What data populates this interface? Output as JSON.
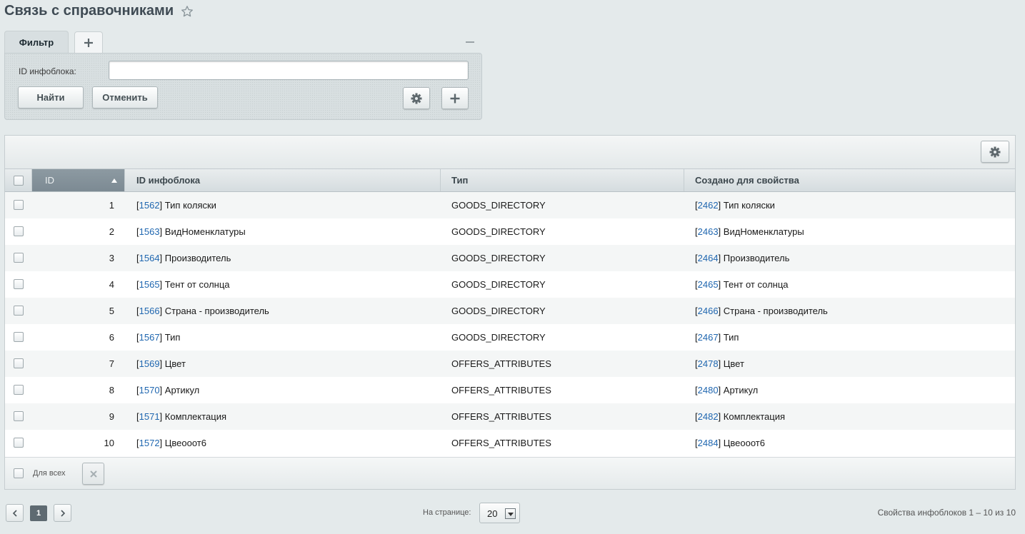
{
  "page": {
    "title": "Связь с справочниками"
  },
  "filter": {
    "tab_label": "Фильтр",
    "field_label": "ID инфоблока:",
    "field_value": "",
    "find_label": "Найти",
    "cancel_label": "Отменить"
  },
  "grid": {
    "columns": {
      "id": "ID",
      "iblock": "ID инфоблока",
      "type": "Тип",
      "prop": "Создано для свойства"
    },
    "rows": [
      {
        "id": "1",
        "ib_id": "1562",
        "ib_name": "Тип коляски",
        "type": "GOODS_DIRECTORY",
        "prop_id": "2462",
        "prop_name": "Тип коляски"
      },
      {
        "id": "2",
        "ib_id": "1563",
        "ib_name": "ВидНоменклатуры",
        "type": "GOODS_DIRECTORY",
        "prop_id": "2463",
        "prop_name": "ВидНоменклатуры"
      },
      {
        "id": "3",
        "ib_id": "1564",
        "ib_name": "Производитель",
        "type": "GOODS_DIRECTORY",
        "prop_id": "2464",
        "prop_name": "Производитель"
      },
      {
        "id": "4",
        "ib_id": "1565",
        "ib_name": "Тент от солнца",
        "type": "GOODS_DIRECTORY",
        "prop_id": "2465",
        "prop_name": "Тент от солнца"
      },
      {
        "id": "5",
        "ib_id": "1566",
        "ib_name": "Страна - производитель",
        "type": "GOODS_DIRECTORY",
        "prop_id": "2466",
        "prop_name": "Страна - производитель"
      },
      {
        "id": "6",
        "ib_id": "1567",
        "ib_name": "Тип",
        "type": "GOODS_DIRECTORY",
        "prop_id": "2467",
        "prop_name": "Тип"
      },
      {
        "id": "7",
        "ib_id": "1569",
        "ib_name": "Цвет",
        "type": "OFFERS_ATTRIBUTES",
        "prop_id": "2478",
        "prop_name": "Цвет"
      },
      {
        "id": "8",
        "ib_id": "1570",
        "ib_name": "Артикул",
        "type": "OFFERS_ATTRIBUTES",
        "prop_id": "2480",
        "prop_name": "Артикул"
      },
      {
        "id": "9",
        "ib_id": "1571",
        "ib_name": "Комплектация",
        "type": "OFFERS_ATTRIBUTES",
        "prop_id": "2482",
        "prop_name": "Комплектация"
      },
      {
        "id": "10",
        "ib_id": "1572",
        "ib_name": "Цвеооот6",
        "type": "OFFERS_ATTRIBUTES",
        "prop_id": "2484",
        "prop_name": "Цвеооот6"
      }
    ],
    "footer": {
      "for_all_label": "Для всех"
    }
  },
  "pager": {
    "current_page": "1",
    "per_page_label": "На странице:",
    "per_page_value": "20",
    "total_text": "Свойства инфоблоков 1 – 10 из 10"
  },
  "colors": {
    "link": "#2067b0",
    "sorted_header": "#8d9aa2"
  },
  "icons": [
    "star-icon",
    "plus-icon",
    "minus-icon",
    "gear-icon",
    "close-icon",
    "chevron-left-icon",
    "chevron-right-icon",
    "dropdown-arrow-icon"
  ]
}
